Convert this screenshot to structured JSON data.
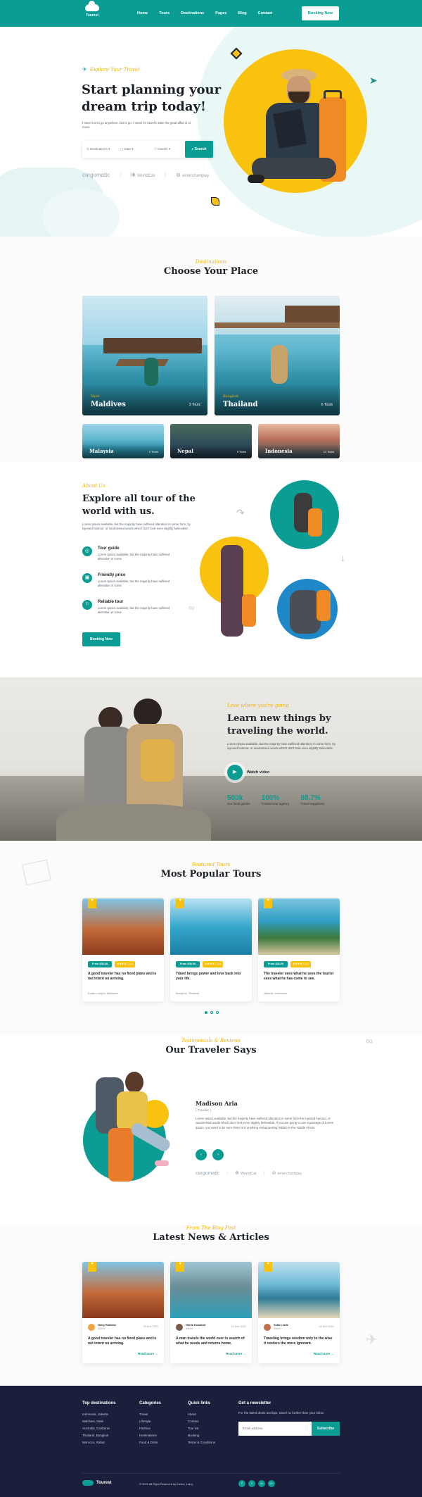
{
  "brand": {
    "name": "Tourest"
  },
  "nav": {
    "items": [
      "Home",
      "Tours",
      "Destinations",
      "Pages",
      "Blog",
      "Contact"
    ],
    "cta": "Booking Now"
  },
  "hero": {
    "tag": "Explore Your Travel",
    "title_line1": "Start planning your",
    "title_line2": "dream trip today!",
    "desc": "I travel not to go anywhere, but to go. I travel for travel's sake the great affair is to move.",
    "search": {
      "destination": "Destinations",
      "date": "Date",
      "guests": "Guests",
      "button": "Search"
    },
    "partners": [
      "cargomatic",
      "WorldCat",
      "emerchantpay"
    ]
  },
  "destinations": {
    "tag": "Destinations",
    "title": "Choose Your Place",
    "big": [
      {
        "sub": "Male",
        "name": "Maldives",
        "tours": "3 Tours"
      },
      {
        "sub": "Bangkok",
        "name": "Thailand",
        "tours": "5 Tours"
      }
    ],
    "small": [
      {
        "name": "Malaysia",
        "tours": "2 Tours"
      },
      {
        "name": "Nepal",
        "tours": "5 Tours"
      },
      {
        "name": "Indonesia",
        "tours": "12 Tours"
      }
    ]
  },
  "about": {
    "tag": "About Us",
    "title_line1": "Explore all tour of the",
    "title_line2": "world with us.",
    "desc": "Lorem Ipsum available, but the majority have suffered alteration in some form, by injected humour, or randomised words which don't look even slightly believable.",
    "features": [
      {
        "title": "Tour guide",
        "desc": "Lorem Ipsum available, but the majority have suffered alteration in some"
      },
      {
        "title": "Friendly price",
        "desc": "Lorem Ipsum available, but the majority have suffered alteration in some"
      },
      {
        "title": "Reliable tour",
        "desc": "Lorem Ipsum available, but the majority have suffered alteration in some"
      }
    ],
    "cta": "Booking Now"
  },
  "learn": {
    "tag": "Love where you're going",
    "title_line1": "Learn new things by",
    "title_line2": "traveling the world.",
    "desc": "Lorem Ipsum available, but the majority have suffered alteration in some form, by injected humour, or randomised words which don't look even slightly believable.",
    "video": "Watch video",
    "stats": [
      {
        "value": "500k",
        "label": "Our local guides"
      },
      {
        "value": "100%",
        "label": "Trusted tour agency"
      },
      {
        "value": "98.7%",
        "label": "Travel happiness"
      }
    ]
  },
  "tours": {
    "tag": "Featured Tours",
    "title": "Most Popular Tours",
    "cards": [
      {
        "price": "From $35.00",
        "rating": "4.5",
        "title": "A good traveler has no fixed plans and is not intent on arriving.",
        "location": "Kuala Lumpur, Malaysia"
      },
      {
        "price": "From $35.00",
        "rating": "4.5",
        "title": "Travel brings power and love back into your life.",
        "location": "Bangkok, Thailand"
      },
      {
        "price": "From $35.00",
        "rating": "4.5",
        "title": "The traveler sees what he sees the tourist sees what he has come to see.",
        "location": "Jakarta, Indonesia"
      }
    ]
  },
  "testimonial": {
    "tag": "Testimonials & Reviews",
    "title": "Our Traveler Says",
    "name": "Madison Aria",
    "role": "( Traveler )",
    "text": "Lorem Ipsum available, but the majority have suffered alteration in some form the injected humour, or randomised words which don't look even slightly believable. If you are going to use a passage of Lorem Ipsum, you need to be sure there isn't anything embarrassing hidden in the middle of text.",
    "partners": [
      "cargomatic",
      "WorldCat",
      "emerchantpay"
    ]
  },
  "news": {
    "tag": "From The Blog Post",
    "title": "Latest News & Articles",
    "cards": [
      {
        "author": "Harry Robbins",
        "role": "Admin",
        "date": "25 Nov 2021",
        "title": "A good traveler has no fixed plans and is not intent on arriving.",
        "cta": "Read more"
      },
      {
        "author": "Harris Kowalski",
        "role": "Admin",
        "date": "25 Nov 2021",
        "title": "A man travels the world over in search of what he needs and returns home.",
        "cta": "Read more"
      },
      {
        "author": "Sofia Lewis",
        "role": "Admin",
        "date": "25 Nov 2021",
        "title": "Traveling brings wisdom only to the wise it renders the more ignorant.",
        "cta": "Read more"
      }
    ]
  },
  "footer": {
    "cols": [
      {
        "title": "Top destinations",
        "items": [
          "Indonesia, Jakarta",
          "Maldives, Malé",
          "Australia, Canberra",
          "Thailand, Bangkok",
          "Morocco, Rabat"
        ]
      },
      {
        "title": "Categories",
        "items": [
          "Travel",
          "Lifestyle",
          "Fashion",
          "Destinations",
          "Food & Drink"
        ]
      },
      {
        "title": "Quick links",
        "items": [
          "About",
          "Contact",
          "Tour list",
          "Booking",
          "Terms & Conditions"
        ]
      }
    ],
    "newsletter": {
      "title": "Get a newsletter",
      "desc": "For the latest deals and tips, travel no further than your inbox",
      "placeholder": "Email address",
      "button": "Subscribe"
    },
    "brand": "Tourest",
    "copyright": "© 2021 All Right Reserved by theme_crazy",
    "social": [
      "f",
      "t",
      "in",
      "G+"
    ]
  },
  "colors": {
    "accent": "#0b9d94",
    "yellow": "#f8c20f",
    "dark": "#1c1f3b",
    "blue": "#1f88c9"
  }
}
